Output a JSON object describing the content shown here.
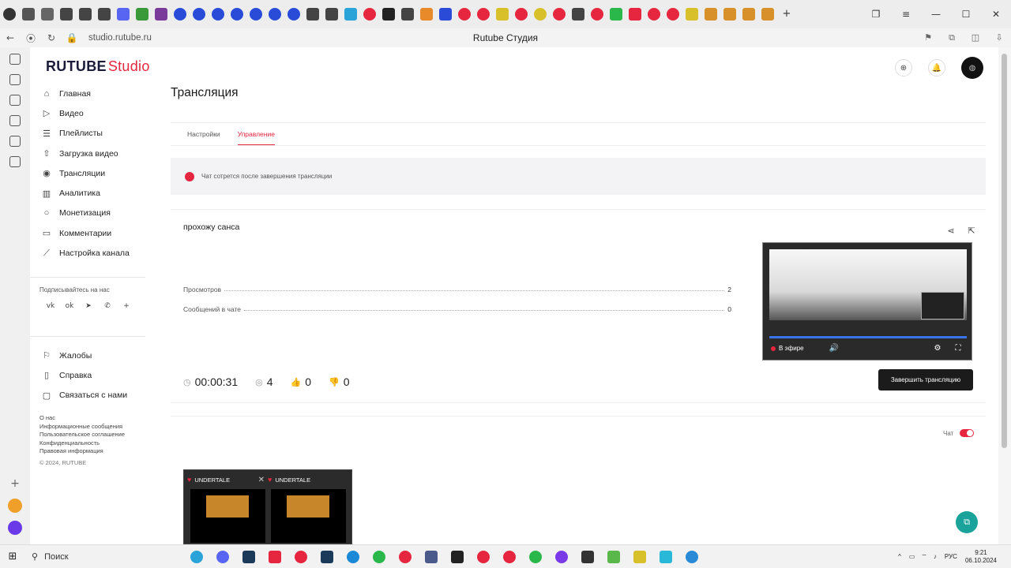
{
  "browser": {
    "url": "studio.rutube.ru",
    "window_title": "Rutube Студия"
  },
  "brand": {
    "name": "RUTUBE",
    "suffix": "Studio"
  },
  "nav": {
    "items": [
      {
        "label": "Главная",
        "icon": "home-icon"
      },
      {
        "label": "Видео",
        "icon": "video-icon"
      },
      {
        "label": "Плейлисты",
        "icon": "playlist-icon"
      },
      {
        "label": "Загрузка видео",
        "icon": "upload-icon"
      },
      {
        "label": "Трансляции",
        "icon": "broadcast-icon"
      },
      {
        "label": "Аналитика",
        "icon": "analytics-icon"
      },
      {
        "label": "Монетизация",
        "icon": "money-icon"
      },
      {
        "label": "Комментарии",
        "icon": "comments-icon"
      },
      {
        "label": "Настройка канала",
        "icon": "wand-icon"
      }
    ],
    "social_title": "Подписывайтесь на нас",
    "bottom_items": [
      {
        "label": "Жалобы"
      },
      {
        "label": "Справка"
      },
      {
        "label": "Связаться с нами"
      }
    ],
    "footer_links": [
      "О нас",
      "Информационные сообщения",
      "Пользовательское соглашение",
      "Конфиденциальность",
      "Правовая информация"
    ],
    "copyright": "© 2024, RUTUBE"
  },
  "page": {
    "title": "Трансляция",
    "tabs": [
      {
        "label": "Настройки",
        "active": false
      },
      {
        "label": "Управление",
        "active": true
      }
    ],
    "notice": "Чат сотрется после завершения трансляции",
    "stream": {
      "title": "прохожу санса",
      "stats": [
        {
          "label": "Просмотров",
          "value": "2"
        },
        {
          "label": "Сообщений в чате",
          "value": "0"
        }
      ],
      "duration": "00:00:31",
      "viewers": "4",
      "likes": "0",
      "dislikes": "0",
      "live_label": "В эфире",
      "end_button": "Завершить трансляцию"
    },
    "chat": {
      "label": "Чат",
      "enabled": true
    }
  },
  "thumbnails": [
    {
      "title": "UNDERTALE"
    },
    {
      "title": "UNDERTALE"
    }
  ],
  "taskbar": {
    "search_label": "Поиск",
    "lang": "РУС",
    "time": "9:21",
    "date": "06.10.2024"
  },
  "colors": {
    "accent": "#e6263e",
    "dark_button": "#1b1b1b",
    "fab": "#1aa39a"
  }
}
